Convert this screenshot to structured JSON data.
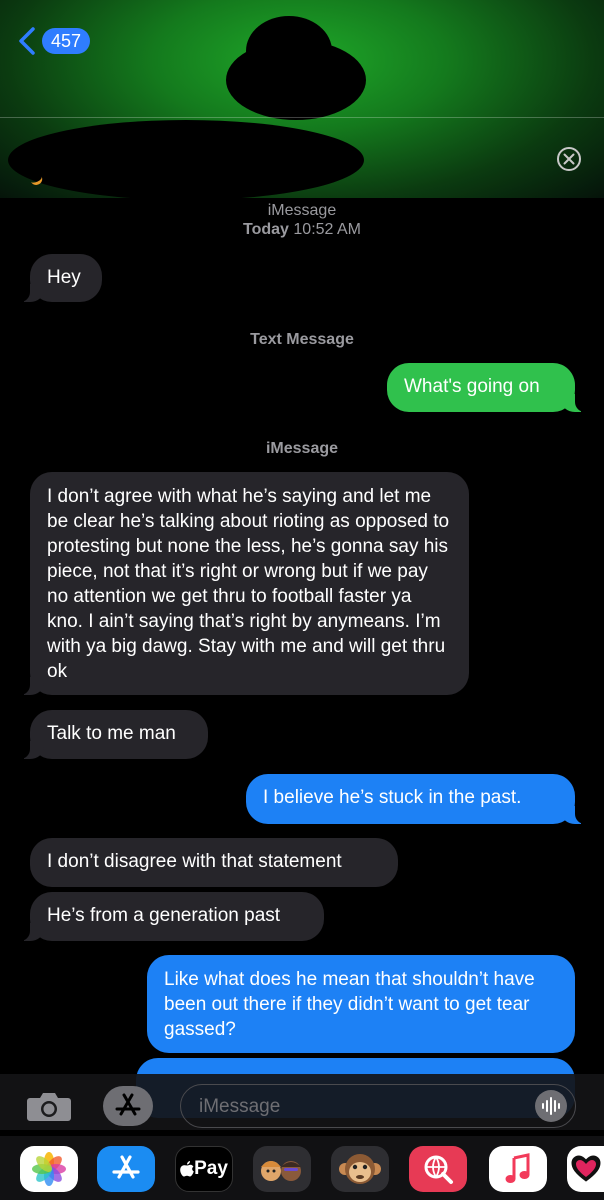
{
  "header": {
    "back_count": "457"
  },
  "thread": {
    "stamp1_service": "iMessage",
    "stamp1_day": "Today",
    "stamp1_time": "10:52 AM",
    "stamp2_service": "Text Message",
    "stamp3_service": "iMessage"
  },
  "messages": [
    {
      "from": "them",
      "text": "Hey"
    },
    {
      "from": "me",
      "service": "sms",
      "text": "What's going on"
    },
    {
      "from": "them",
      "text": "I don’t agree with what he’s saying and let me be clear he’s talking about rioting as opposed to protesting but none the less, he’s gonna say his piece, not that it’s right or wrong but if we pay no attention we get thru to football faster ya kno.  I ain’t saying that’s right by anymeans. I’m with ya big dawg. Stay with me and will get thru ok"
    },
    {
      "from": "them",
      "text": "Talk to me man"
    },
    {
      "from": "me",
      "service": "imessage",
      "text": "I believe he’s stuck in the past."
    },
    {
      "from": "them",
      "text": "I don’t disagree with that statement"
    },
    {
      "from": "them",
      "text": "He’s from a generation past"
    },
    {
      "from": "me",
      "service": "imessage",
      "text": "Like what does he mean that shouldn’t have been out there if they didn’t want to get tear gassed?"
    }
  ],
  "composer": {
    "placeholder": "iMessage"
  },
  "drawer": {
    "apps": [
      "photos-icon",
      "app-store-icon",
      "apple-pay-icon",
      "memoji-icon",
      "animoji-icon",
      "web-images-icon",
      "music-icon",
      "heart-app-icon"
    ],
    "pay_label": "Pay"
  },
  "colors": {
    "incoming": "#26252a",
    "outgoing_imessage": "#1d81f5",
    "outgoing_sms": "#30c14d",
    "link_blue": "#2f7dff"
  }
}
